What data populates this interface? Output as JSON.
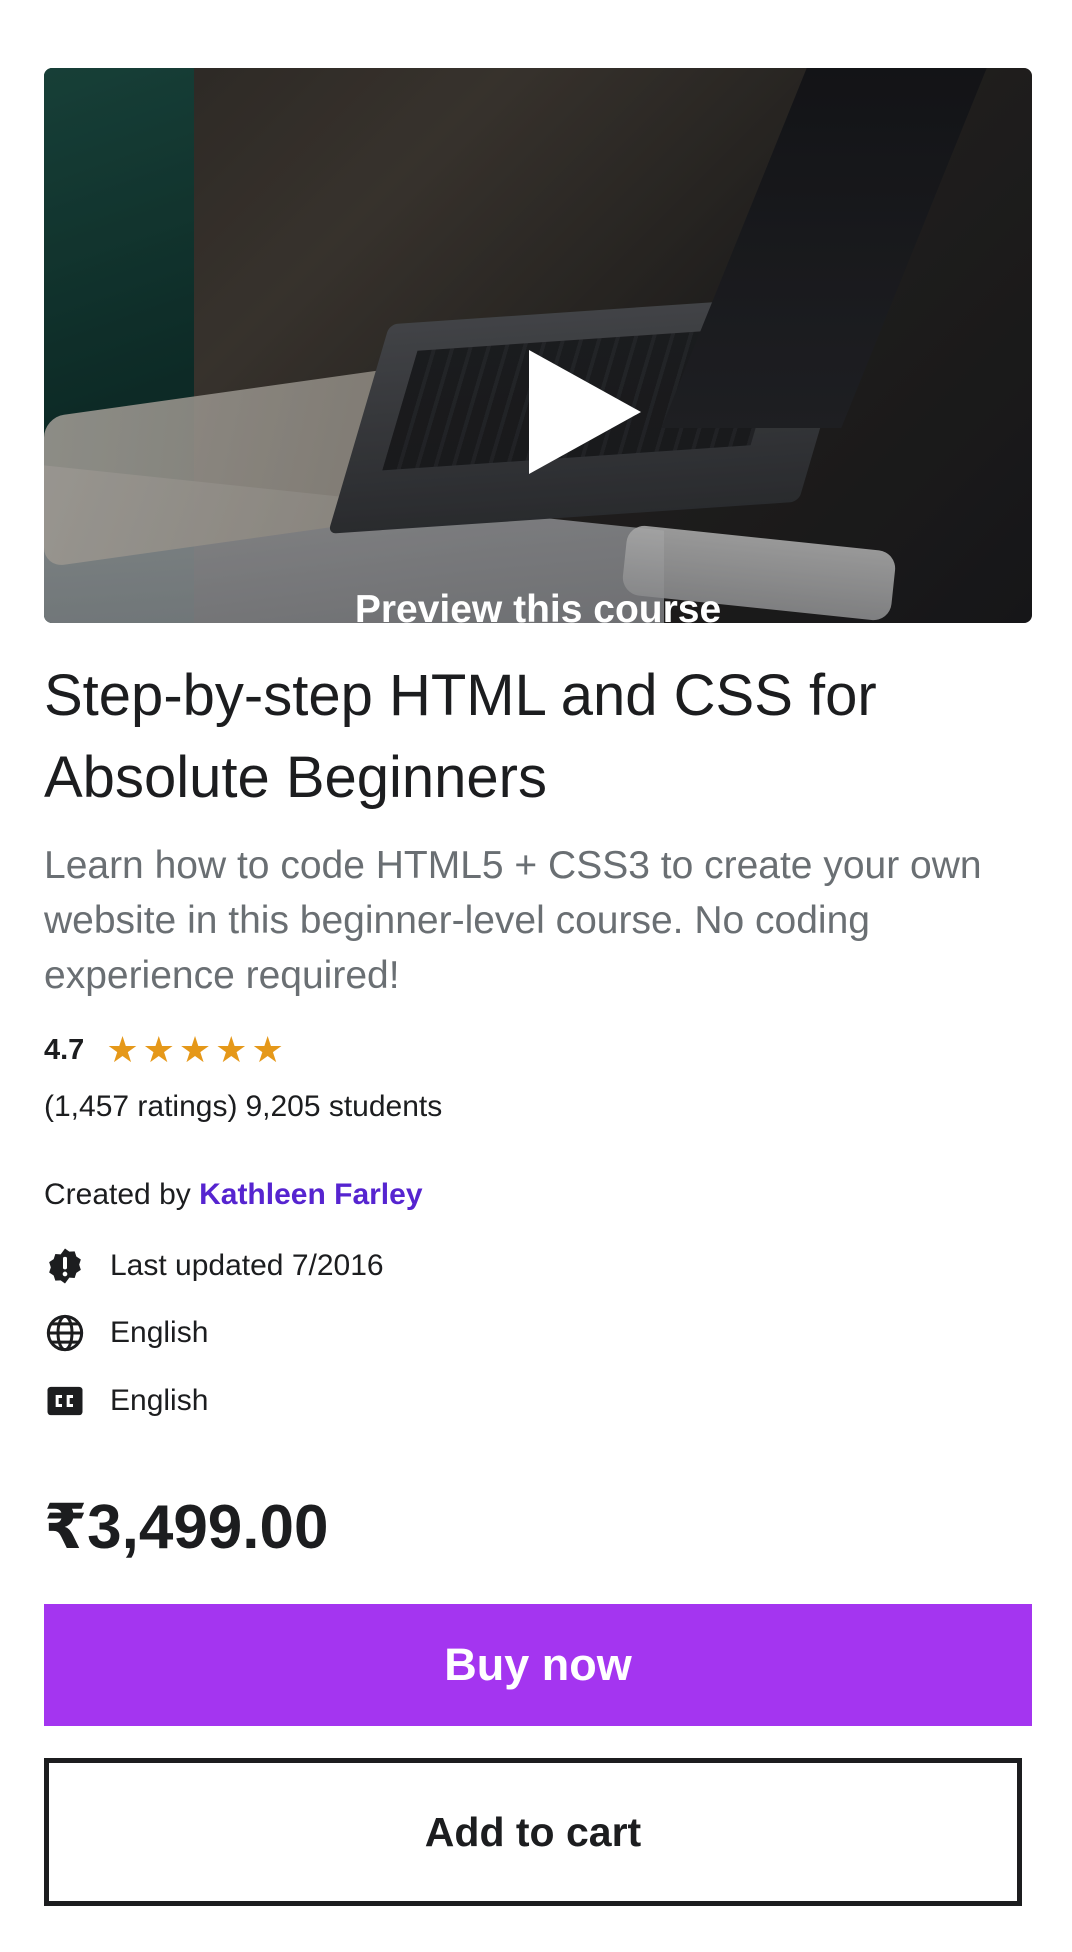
{
  "preview": {
    "label": "Preview this course"
  },
  "course": {
    "title": "Step-by-step HTML and CSS for Absolute Beginners",
    "subtitle": "Learn how to code HTML5 + CSS3 to create your own website in this beginner-level course. No coding experience required!",
    "rating": "4.7",
    "stars": 5,
    "ratings_count": "(1,457 ratings)",
    "students": "9,205 students",
    "created_by_label": "Created by",
    "instructor": "Kathleen Farley",
    "last_updated": "Last updated 7/2016",
    "language": "English",
    "captions": "English",
    "price": "₹3,499.00"
  },
  "actions": {
    "buy_label": "Buy now",
    "cart_label": "Add to cart"
  },
  "colors": {
    "accent": "#a435f0",
    "link": "#5624d0",
    "star": "#e59819"
  },
  "icons": {
    "updated": "alert-badge-icon",
    "language": "globe-icon",
    "captions": "closed-captions-icon"
  }
}
